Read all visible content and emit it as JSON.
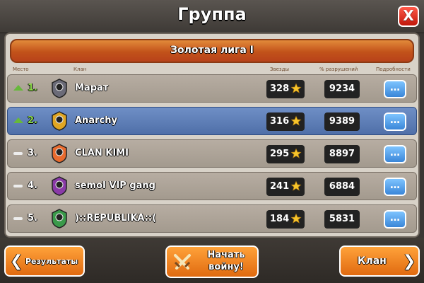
{
  "header": {
    "title": "Группа",
    "close_label": "X"
  },
  "league": {
    "name": "Золотая лига I"
  },
  "columns": {
    "place": "Место",
    "clan": "Клан",
    "stars": "Звезды",
    "destruction": "% разрушений",
    "details": "Подробности"
  },
  "rows": [
    {
      "rank": "1.",
      "trend": "up",
      "clan": "Марат",
      "stars": "328",
      "destruction": "9234",
      "badge_color": "#6b6b78",
      "highlight": false
    },
    {
      "rank": "2.",
      "trend": "up",
      "clan": "Anarchy",
      "stars": "316",
      "destruction": "9389",
      "badge_color": "#e0a623",
      "highlight": true
    },
    {
      "rank": "3.",
      "trend": "none",
      "clan": "CLAN KIMI",
      "stars": "295",
      "destruction": "8897",
      "badge_color": "#e86b2e",
      "highlight": false
    },
    {
      "rank": "4.",
      "trend": "none",
      "clan": "semoI VIP gang",
      "stars": "241",
      "destruction": "6884",
      "badge_color": "#8a3aa8",
      "highlight": false
    },
    {
      "rank": "5.",
      "trend": "none",
      "clan": ")::REPUBLIKA::(",
      "stars": "184",
      "destruction": "5831",
      "badge_color": "#3a9a4a",
      "highlight": false
    }
  ],
  "footer": {
    "results_label": "Результаты",
    "start_war_line1": "Начать",
    "start_war_line2": "войну!",
    "clan_label": "Клан"
  },
  "colors": {
    "accent_orange": "#f08a1e",
    "highlight_blue": "#5b7fba",
    "trend_up_green": "#67b83b"
  }
}
